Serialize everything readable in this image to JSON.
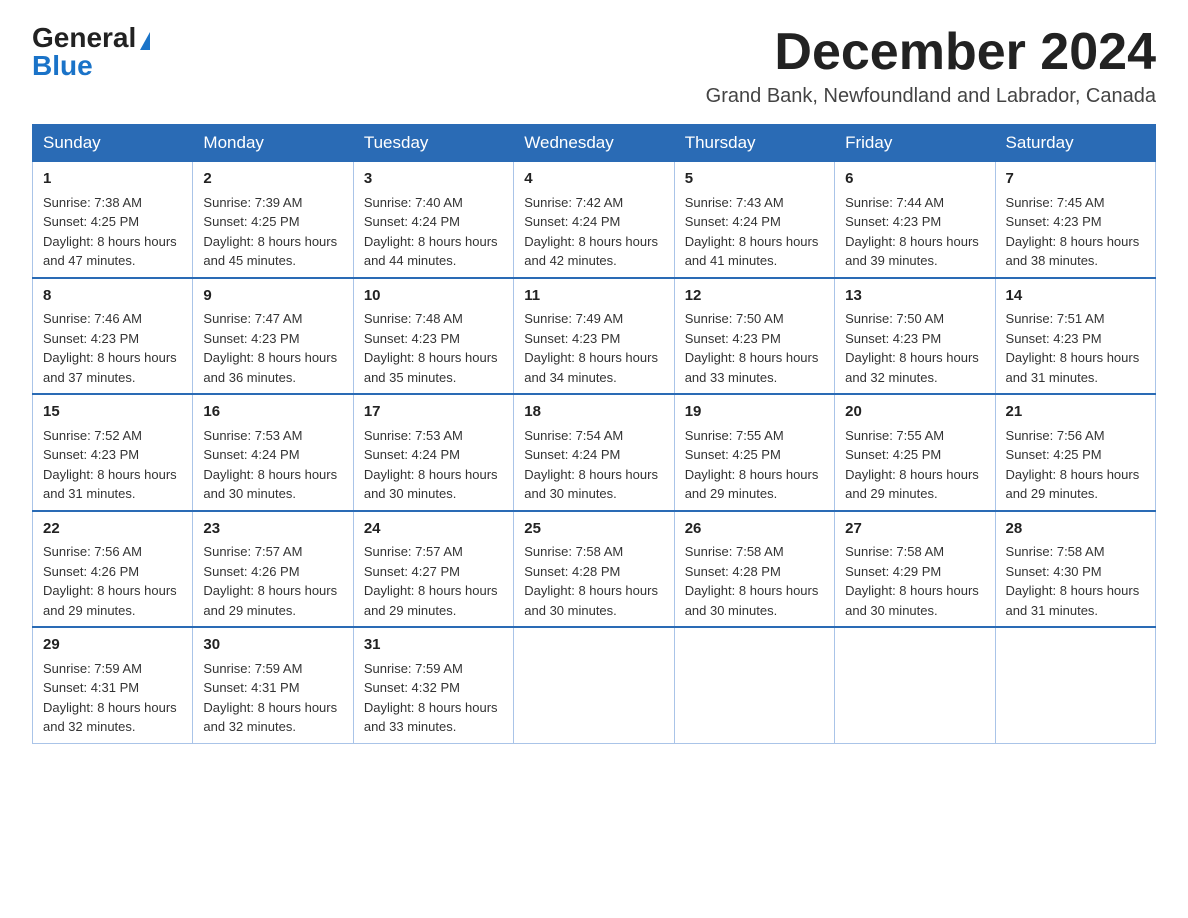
{
  "logo": {
    "general": "General",
    "blue": "Blue"
  },
  "title": "December 2024",
  "location": "Grand Bank, Newfoundland and Labrador, Canada",
  "weekdays": [
    "Sunday",
    "Monday",
    "Tuesday",
    "Wednesday",
    "Thursday",
    "Friday",
    "Saturday"
  ],
  "weeks": [
    [
      {
        "day": "1",
        "sunrise": "7:38 AM",
        "sunset": "4:25 PM",
        "daylight": "8 hours and 47 minutes."
      },
      {
        "day": "2",
        "sunrise": "7:39 AM",
        "sunset": "4:25 PM",
        "daylight": "8 hours and 45 minutes."
      },
      {
        "day": "3",
        "sunrise": "7:40 AM",
        "sunset": "4:24 PM",
        "daylight": "8 hours and 44 minutes."
      },
      {
        "day": "4",
        "sunrise": "7:42 AM",
        "sunset": "4:24 PM",
        "daylight": "8 hours and 42 minutes."
      },
      {
        "day": "5",
        "sunrise": "7:43 AM",
        "sunset": "4:24 PM",
        "daylight": "8 hours and 41 minutes."
      },
      {
        "day": "6",
        "sunrise": "7:44 AM",
        "sunset": "4:23 PM",
        "daylight": "8 hours and 39 minutes."
      },
      {
        "day": "7",
        "sunrise": "7:45 AM",
        "sunset": "4:23 PM",
        "daylight": "8 hours and 38 minutes."
      }
    ],
    [
      {
        "day": "8",
        "sunrise": "7:46 AM",
        "sunset": "4:23 PM",
        "daylight": "8 hours and 37 minutes."
      },
      {
        "day": "9",
        "sunrise": "7:47 AM",
        "sunset": "4:23 PM",
        "daylight": "8 hours and 36 minutes."
      },
      {
        "day": "10",
        "sunrise": "7:48 AM",
        "sunset": "4:23 PM",
        "daylight": "8 hours and 35 minutes."
      },
      {
        "day": "11",
        "sunrise": "7:49 AM",
        "sunset": "4:23 PM",
        "daylight": "8 hours and 34 minutes."
      },
      {
        "day": "12",
        "sunrise": "7:50 AM",
        "sunset": "4:23 PM",
        "daylight": "8 hours and 33 minutes."
      },
      {
        "day": "13",
        "sunrise": "7:50 AM",
        "sunset": "4:23 PM",
        "daylight": "8 hours and 32 minutes."
      },
      {
        "day": "14",
        "sunrise": "7:51 AM",
        "sunset": "4:23 PM",
        "daylight": "8 hours and 31 minutes."
      }
    ],
    [
      {
        "day": "15",
        "sunrise": "7:52 AM",
        "sunset": "4:23 PM",
        "daylight": "8 hours and 31 minutes."
      },
      {
        "day": "16",
        "sunrise": "7:53 AM",
        "sunset": "4:24 PM",
        "daylight": "8 hours and 30 minutes."
      },
      {
        "day": "17",
        "sunrise": "7:53 AM",
        "sunset": "4:24 PM",
        "daylight": "8 hours and 30 minutes."
      },
      {
        "day": "18",
        "sunrise": "7:54 AM",
        "sunset": "4:24 PM",
        "daylight": "8 hours and 30 minutes."
      },
      {
        "day": "19",
        "sunrise": "7:55 AM",
        "sunset": "4:25 PM",
        "daylight": "8 hours and 29 minutes."
      },
      {
        "day": "20",
        "sunrise": "7:55 AM",
        "sunset": "4:25 PM",
        "daylight": "8 hours and 29 minutes."
      },
      {
        "day": "21",
        "sunrise": "7:56 AM",
        "sunset": "4:25 PM",
        "daylight": "8 hours and 29 minutes."
      }
    ],
    [
      {
        "day": "22",
        "sunrise": "7:56 AM",
        "sunset": "4:26 PM",
        "daylight": "8 hours and 29 minutes."
      },
      {
        "day": "23",
        "sunrise": "7:57 AM",
        "sunset": "4:26 PM",
        "daylight": "8 hours and 29 minutes."
      },
      {
        "day": "24",
        "sunrise": "7:57 AM",
        "sunset": "4:27 PM",
        "daylight": "8 hours and 29 minutes."
      },
      {
        "day": "25",
        "sunrise": "7:58 AM",
        "sunset": "4:28 PM",
        "daylight": "8 hours and 30 minutes."
      },
      {
        "day": "26",
        "sunrise": "7:58 AM",
        "sunset": "4:28 PM",
        "daylight": "8 hours and 30 minutes."
      },
      {
        "day": "27",
        "sunrise": "7:58 AM",
        "sunset": "4:29 PM",
        "daylight": "8 hours and 30 minutes."
      },
      {
        "day": "28",
        "sunrise": "7:58 AM",
        "sunset": "4:30 PM",
        "daylight": "8 hours and 31 minutes."
      }
    ],
    [
      {
        "day": "29",
        "sunrise": "7:59 AM",
        "sunset": "4:31 PM",
        "daylight": "8 hours and 32 minutes."
      },
      {
        "day": "30",
        "sunrise": "7:59 AM",
        "sunset": "4:31 PM",
        "daylight": "8 hours and 32 minutes."
      },
      {
        "day": "31",
        "sunrise": "7:59 AM",
        "sunset": "4:32 PM",
        "daylight": "8 hours and 33 minutes."
      },
      null,
      null,
      null,
      null
    ]
  ],
  "labels": {
    "sunrise": "Sunrise:",
    "sunset": "Sunset:",
    "daylight": "Daylight:"
  }
}
